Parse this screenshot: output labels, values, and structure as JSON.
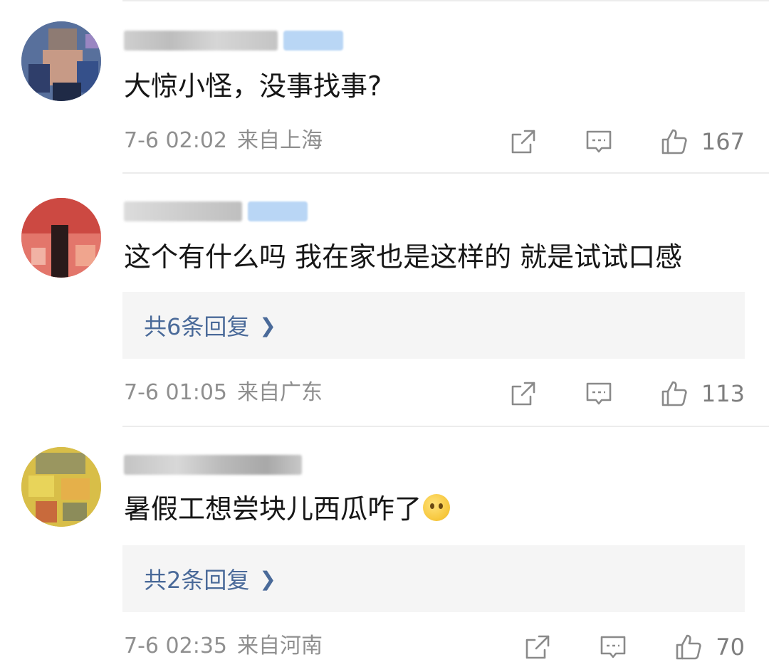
{
  "comments": [
    {
      "text": "大惊小怪，没事找事?",
      "time": "7-6 02:02",
      "location": "来自上海",
      "likes": "167",
      "replies": null
    },
    {
      "text": "这个有什么吗 我在家也是这样的 就是试试口感",
      "time": "7-6 01:05",
      "location": "来自广东",
      "likes": "113",
      "replies": "共6条回复"
    },
    {
      "text": "暑假工想尝块儿西瓜咋了",
      "time": "7-6 02:35",
      "location": "来自河南",
      "likes": "70",
      "replies": "共2条回复"
    }
  ],
  "icons": {
    "share": "share-icon",
    "comment": "comment-icon",
    "like": "thumbs-up-icon",
    "reply_more": "chevron-right-icon",
    "emoji": "peek-face-emoji"
  },
  "colors": {
    "reply_link": "#4a6a99",
    "meta_text": "#8f8f8f",
    "reply_box_bg": "#f5f5f5",
    "badge": "#b9d6f5"
  }
}
